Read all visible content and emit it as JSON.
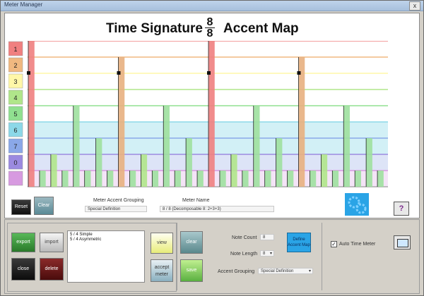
{
  "window": {
    "title": "Meter Manager",
    "close_label": "x"
  },
  "heading": {
    "part1": "Time Signature",
    "numerator": "8",
    "denominator": "8",
    "part2": "Accent Map"
  },
  "accent_levels": [
    "1",
    "2",
    "3",
    "4",
    "5",
    "6",
    "7",
    "0",
    ""
  ],
  "level_colors": [
    "#f08080",
    "#f0b880",
    "#fff7a8",
    "#b0e68a",
    "#90e090",
    "#8cd8e8",
    "#8aa8e8",
    "#9b8ae0",
    "#d79ae0"
  ],
  "grid": {
    "beats": 32,
    "accent_levels_per_beat": [
      1,
      9,
      8,
      9,
      5,
      9,
      7,
      9,
      2,
      9,
      8,
      9,
      5,
      9,
      7,
      9,
      1,
      9,
      8,
      9,
      5,
      9,
      7,
      9,
      2,
      9,
      8,
      9,
      5,
      9,
      7,
      9
    ]
  },
  "upper_controls": {
    "reset_label": "Reset",
    "clear_label": "Clear",
    "meter_accent_grouping_label": "Meter Accent Grouping",
    "meter_accent_grouping_value": "Special Definition",
    "meter_name_label": "Meter Name",
    "meter_name_value": "8 / 8 (Decomposable 8: 2+3+3)",
    "help_label": "?"
  },
  "lower_controls": {
    "export_label": "export",
    "import_label": "import",
    "close_label": "close",
    "delete_label": "delete",
    "meter_list": [
      "5 / 4   Simple",
      "5 / 4   Asymmetric"
    ],
    "view_label": "view",
    "accept_label": "accept meter",
    "clear_label": "clear",
    "save_label": "save",
    "note_count_label": "Note Count",
    "note_count_value": "8",
    "note_length_label": "Note Length",
    "note_length_value": "8",
    "accent_grouping_label": "Accent Grouping",
    "accent_grouping_value": "Special Definition",
    "define_accent_label": "Define Accent Map",
    "auto_time_meter_label": "Auto Time Meter",
    "auto_time_meter_checked": true
  }
}
